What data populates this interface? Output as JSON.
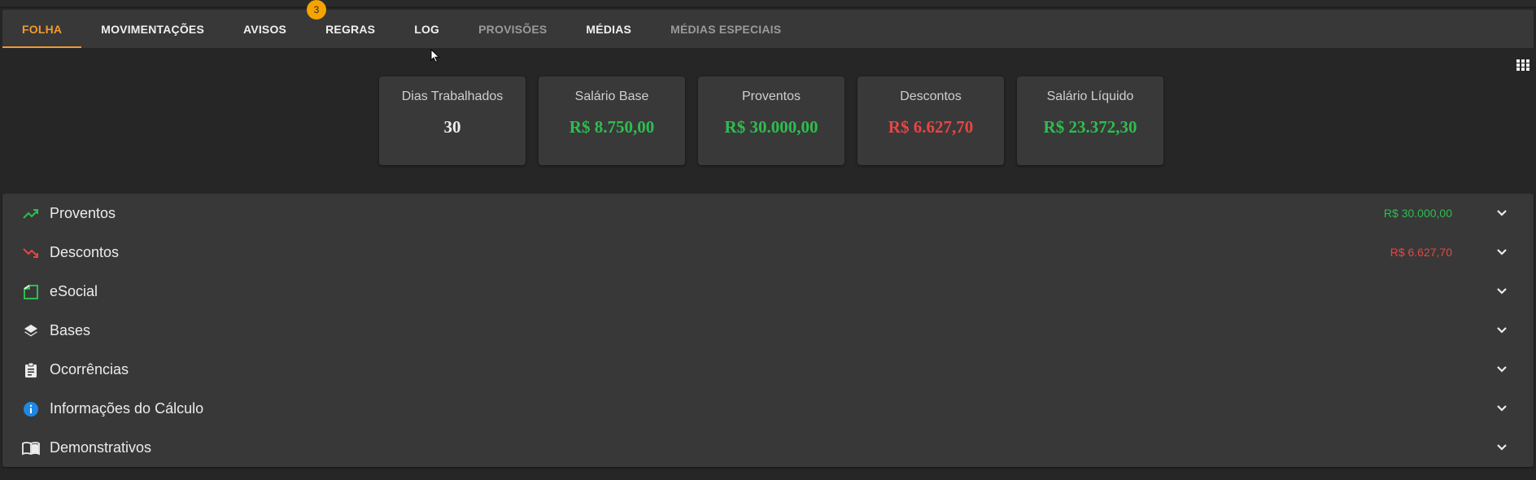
{
  "tabs": [
    {
      "label": "FOLHA",
      "state": "active"
    },
    {
      "label": "MOVIMENTAÇÕES",
      "state": "normal"
    },
    {
      "label": "AVISOS",
      "state": "normal",
      "badge": "3"
    },
    {
      "label": "REGRAS",
      "state": "normal"
    },
    {
      "label": "LOG",
      "state": "normal"
    },
    {
      "label": "PROVISÕES",
      "state": "disabled"
    },
    {
      "label": "MÉDIAS",
      "state": "normal"
    },
    {
      "label": "MÉDIAS ESPECIAIS",
      "state": "disabled"
    }
  ],
  "summary": {
    "dias": {
      "label": "Dias Trabalhados",
      "value": "30"
    },
    "salario_base": {
      "label": "Salário Base",
      "value": "R$ 8.750,00"
    },
    "proventos": {
      "label": "Proventos",
      "value": "R$ 30.000,00"
    },
    "descontos": {
      "label": "Descontos",
      "value": "R$ 6.627,70"
    },
    "liquido": {
      "label": "Salário Líquido",
      "value": "R$ 23.372,30"
    }
  },
  "sections": [
    {
      "title": "Proventos",
      "total": "R$ 30.000,00",
      "icon": "trending-up-icon"
    },
    {
      "title": "Descontos",
      "total": "R$ 6.627,70",
      "icon": "trending-down-icon"
    },
    {
      "title": "eSocial",
      "icon": "esocial-icon"
    },
    {
      "title": "Bases",
      "icon": "layers-icon"
    },
    {
      "title": "Ocorrências",
      "icon": "clipboard-icon"
    },
    {
      "title": "Informações do Cálculo",
      "icon": "info-icon"
    },
    {
      "title": "Demonstrativos",
      "icon": "book-icon"
    }
  ],
  "colors": {
    "accent": "#f29a2e",
    "positive": "#2ebd4f",
    "negative": "#e84545",
    "badge": "#f5a300",
    "info": "#1e88e5"
  }
}
